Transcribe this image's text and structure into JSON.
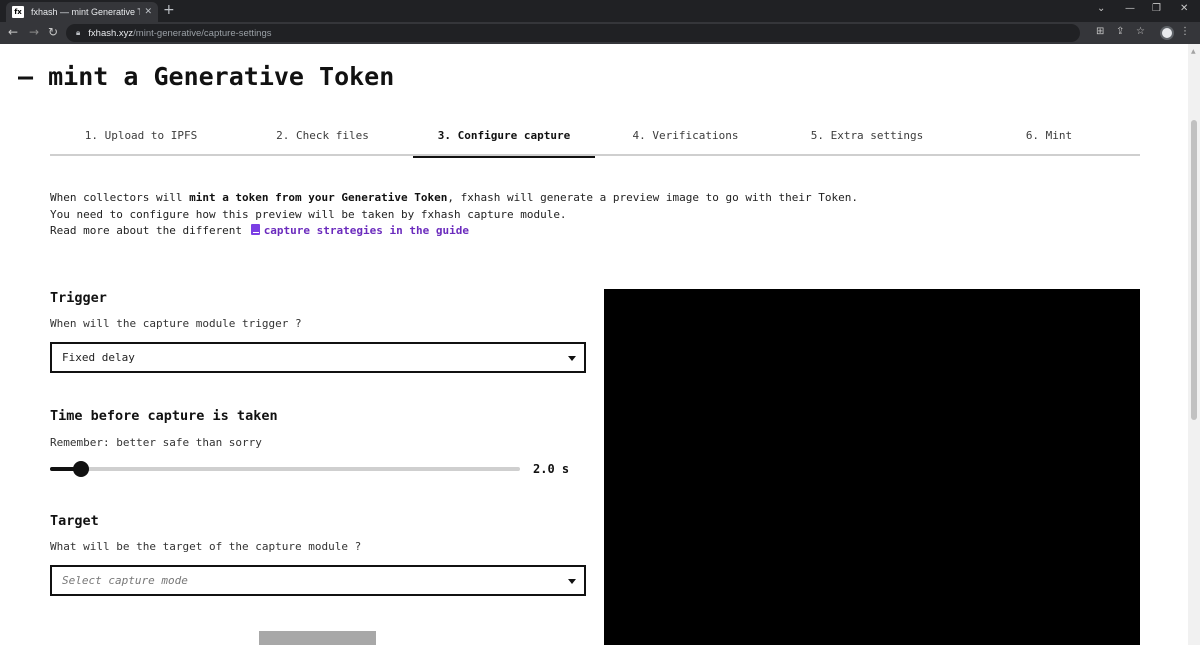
{
  "browser": {
    "tab_title": "fxhash — mint Generative Token",
    "favicon_text": "fx",
    "new_tab": "+",
    "url_host": "fxhash.xyz",
    "url_path": "/mint-generative/capture-settings"
  },
  "page": {
    "title": "– mint a Generative Token"
  },
  "steps": [
    {
      "label": "1. Upload to IPFS",
      "active": false
    },
    {
      "label": "2. Check files",
      "active": false
    },
    {
      "label": "3. Configure capture",
      "active": true
    },
    {
      "label": "4. Verifications",
      "active": false
    },
    {
      "label": "5. Extra settings",
      "active": false
    },
    {
      "label": "6. Mint",
      "active": false
    }
  ],
  "intro": {
    "line1_pre": "When collectors will ",
    "line1_bold": "mint a token from your Generative Token",
    "line1_post": ", fxhash will generate a preview image to go with their Token.",
    "line2": "You need to configure how this preview will be taken by fxhash capture module.",
    "line3_pre": "Read more about the different ",
    "line3_link": "capture strategies in the guide"
  },
  "trigger": {
    "title": "Trigger",
    "description": "When will the capture module trigger ?",
    "selected": "Fixed delay"
  },
  "delay": {
    "title": "Time before capture is taken",
    "description": "Remember: better safe than sorry",
    "value_label": "2.0 s",
    "fraction": 0.065
  },
  "target": {
    "title": "Target",
    "description": "What will be the target of the capture module ?",
    "placeholder": "Select capture mode"
  },
  "colors": {
    "accent_link": "#6b2bbd",
    "preview_bg": "#000000"
  }
}
